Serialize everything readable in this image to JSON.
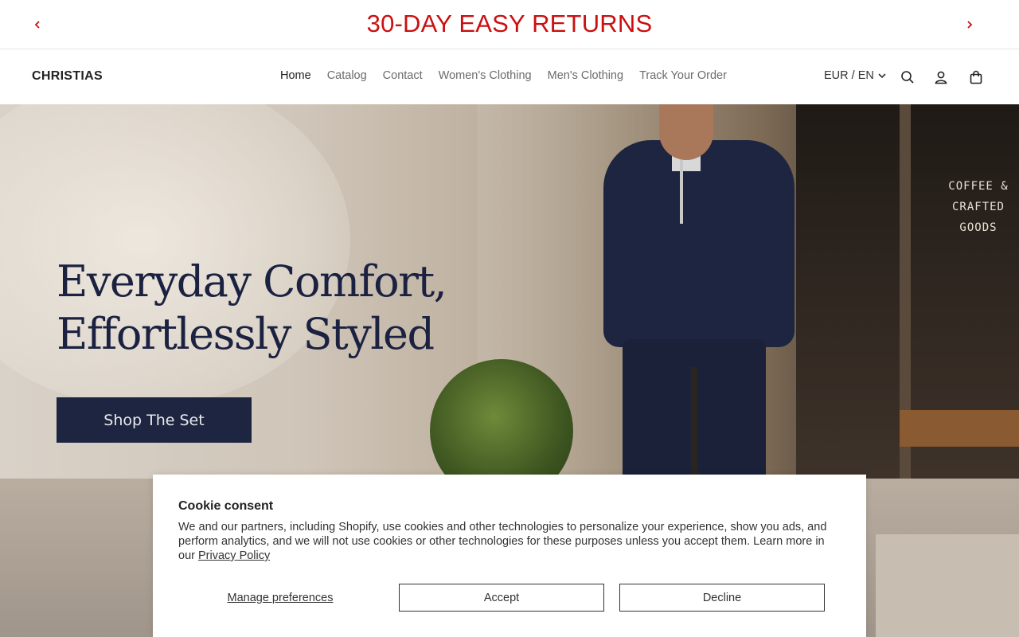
{
  "announcement": {
    "text": "30-DAY EASY RETURNS",
    "prev_icon": "chevron-left-icon",
    "next_icon": "chevron-right-icon",
    "color": "#cc1010"
  },
  "header": {
    "logo": "CHRISTIAS",
    "nav": [
      "Home",
      "Catalog",
      "Contact",
      "Women's Clothing",
      "Men's Clothing",
      "Track Your Order"
    ],
    "locale": "EUR / EN",
    "icons": [
      "search-icon",
      "account-icon",
      "cart-icon"
    ]
  },
  "hero": {
    "heading_line1": "Everyday Comfort,",
    "heading_line2": "Effortlessly Styled",
    "cta": "Shop The Set",
    "window_sign": [
      "COFFEE &",
      "CRAFTED",
      "GOODS"
    ],
    "accent": "#1d2540"
  },
  "cookie": {
    "title": "Cookie consent",
    "body": "We and our partners, including Shopify, use cookies and other technologies to personalize your experience, show you ads, and perform analytics, and we will not use cookies or other technologies for these purposes unless you accept them. Learn more in our ",
    "privacy_link": "Privacy Policy",
    "manage": "Manage preferences",
    "accept": "Accept",
    "decline": "Decline"
  }
}
